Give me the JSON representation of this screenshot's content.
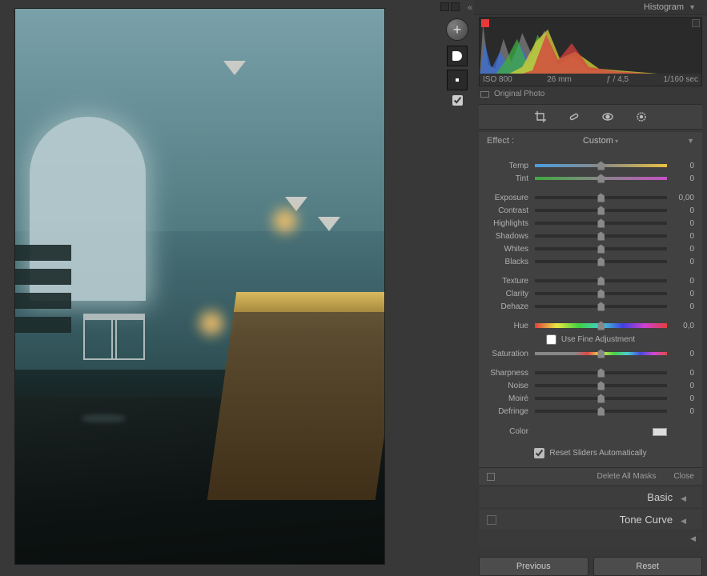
{
  "histogram": {
    "title": "Histogram",
    "iso": "ISO 800",
    "focal": "26 mm",
    "aperture": "ƒ / 4,5",
    "shutter": "1/160 sec",
    "original_label": "Original Photo"
  },
  "effect": {
    "label": "Effect :",
    "value": "Custom"
  },
  "sliders": {
    "temp": {
      "label": "Temp",
      "value": "0"
    },
    "tint": {
      "label": "Tint",
      "value": "0"
    },
    "exposure": {
      "label": "Exposure",
      "value": "0,00"
    },
    "contrast": {
      "label": "Contrast",
      "value": "0"
    },
    "highlights": {
      "label": "Highlights",
      "value": "0"
    },
    "shadows": {
      "label": "Shadows",
      "value": "0"
    },
    "whites": {
      "label": "Whites",
      "value": "0"
    },
    "blacks": {
      "label": "Blacks",
      "value": "0"
    },
    "texture": {
      "label": "Texture",
      "value": "0"
    },
    "clarity": {
      "label": "Clarity",
      "value": "0"
    },
    "dehaze": {
      "label": "Dehaze",
      "value": "0"
    },
    "hue": {
      "label": "Hue",
      "value": "0,0"
    },
    "saturation": {
      "label": "Saturation",
      "value": "0"
    },
    "sharpness": {
      "label": "Sharpness",
      "value": "0"
    },
    "noise": {
      "label": "Noise",
      "value": "0"
    },
    "moire": {
      "label": "Moiré",
      "value": "0"
    },
    "defringe": {
      "label": "Defringe",
      "value": "0"
    }
  },
  "options": {
    "fine_adjust": "Use Fine Adjustment",
    "color": "Color",
    "reset_auto": "Reset Sliders Automatically"
  },
  "mask_foot": {
    "delete": "Delete All Masks",
    "close": "Close"
  },
  "sections": {
    "basic": "Basic",
    "tone_curve": "Tone Curve"
  },
  "buttons": {
    "previous": "Previous",
    "reset": "Reset"
  }
}
